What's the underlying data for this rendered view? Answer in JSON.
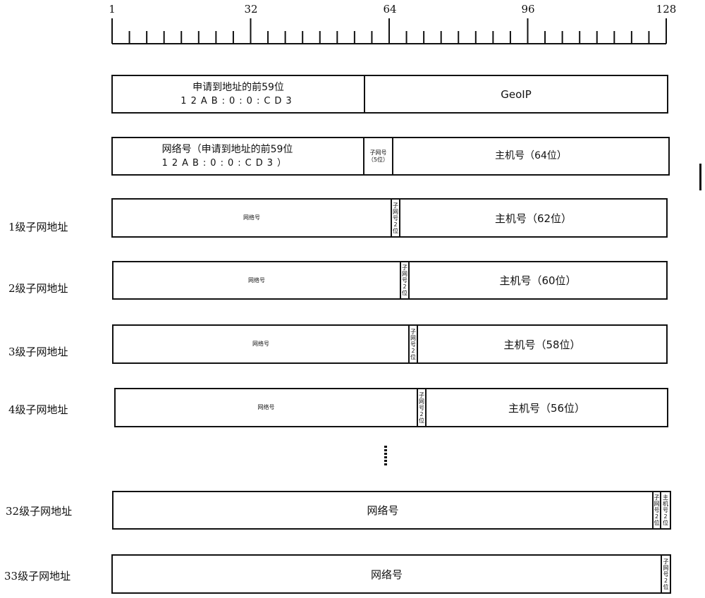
{
  "ruler": {
    "min_bit": 1,
    "max_bit": 128,
    "labels": [
      "1",
      "32",
      "64",
      "96",
      "128"
    ],
    "minor_tick_step_bits": 4,
    "major_tick_bits": [
      1,
      32,
      64,
      96,
      128
    ]
  },
  "row_a": {
    "left_line1": "申请到地址的前59位",
    "left_line2": "12AB:0:0:CD3",
    "right": "GeoIP"
  },
  "row_b": {
    "left_line1": "网络号（申请到地址的前59位",
    "left_line2": "12AB:0:0:CD3）",
    "subnet_line1": "子网号",
    "subnet_line2": "（5位）",
    "host": "主机号（64位）"
  },
  "levels": [
    {
      "label": "1级子网地址",
      "network": "网络号",
      "subnet": "子网号2位",
      "host": "主机号（62位）"
    },
    {
      "label": "2级子网地址",
      "network": "网络号",
      "subnet": "子网号2位",
      "host": "主机号（60位）"
    },
    {
      "label": "3级子网地址",
      "network": "网络号",
      "subnet": "子网号2位",
      "host": "主机号（58位）"
    },
    {
      "label": "4级子网地址",
      "network": "网络号",
      "subnet": "子网号2位",
      "host": "主机号（56位）"
    },
    {
      "label": "32级子网地址",
      "network": "网络号",
      "subnet": "子网号2位",
      "host": "主机号2位"
    },
    {
      "label": "33级子网地址",
      "network": "网络号",
      "subnet": "子网号2位"
    }
  ],
  "ellipsis": "⋮"
}
